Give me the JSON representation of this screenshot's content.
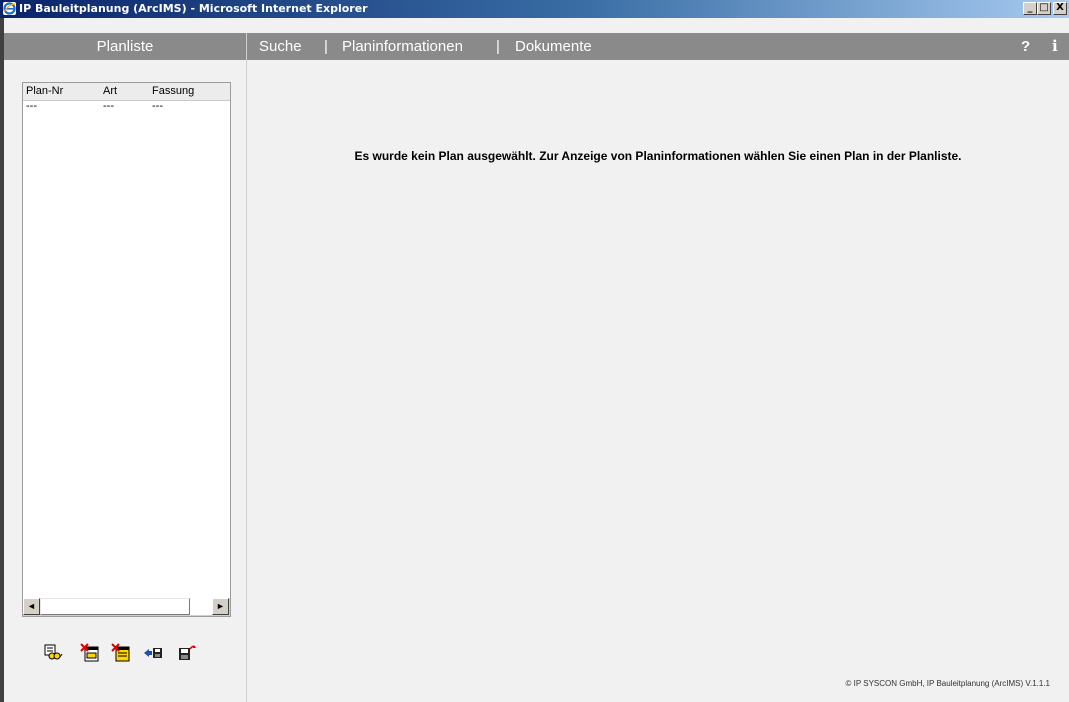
{
  "window": {
    "title": "IP Bauleitplanung (ArcIMS) - Microsoft Internet Explorer",
    "min_glyph": "_",
    "max_glyph": "□",
    "close_glyph": "X"
  },
  "left_panel": {
    "title": "Planliste",
    "columns": [
      "Plan-Nr",
      "Art",
      "Fassung"
    ],
    "rows": [
      [
        "---",
        "---",
        "---"
      ]
    ],
    "scroll_left_glyph": "◄",
    "scroll_right_glyph": "►",
    "tools": [
      {
        "icon": "zoom-to-plan-icon"
      },
      {
        "icon": "remove-plan-icon"
      },
      {
        "icon": "remove-all-plans-icon"
      },
      {
        "icon": "import-plan-icon"
      },
      {
        "icon": "save-plan-list-icon"
      }
    ]
  },
  "nav": {
    "items": [
      "Suche",
      "Planinformationen",
      "Dokumente"
    ],
    "separator": "|",
    "help": "?",
    "info": "i"
  },
  "main": {
    "message": "Es wurde kein Plan ausgewählt. Zur Anzeige von Planinformationen wählen Sie einen Plan in der Planliste.",
    "copyright": "© IP SYSCON GmbH, IP Bauleitplanung (ArcIMS) V.1.1.1"
  },
  "colors": {
    "header_bg": "#8a8a8a",
    "page_bg": "#f1f1f1",
    "titlebar": "#0a246a"
  }
}
